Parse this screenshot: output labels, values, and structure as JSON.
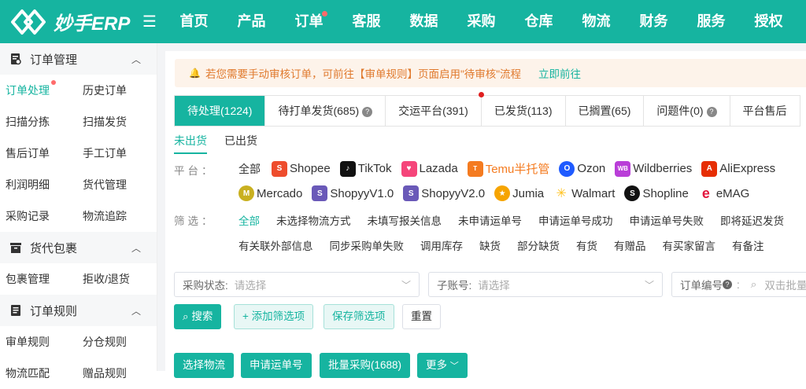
{
  "app": {
    "logo_text": "妙手ERP"
  },
  "nav": {
    "items": [
      {
        "label": "首页"
      },
      {
        "label": "产品"
      },
      {
        "label": "订单"
      },
      {
        "label": "客服"
      },
      {
        "label": "数据"
      },
      {
        "label": "采购"
      },
      {
        "label": "仓库"
      },
      {
        "label": "物流"
      },
      {
        "label": "财务"
      },
      {
        "label": "服务"
      },
      {
        "label": "授权"
      }
    ]
  },
  "sidebar": {
    "groups": [
      {
        "title": "订单管理",
        "items": [
          "订单处理",
          "历史订单",
          "扫描分拣",
          "扫描发货",
          "售后订单",
          "手工订单",
          "利润明细",
          "货代管理",
          "采购记录",
          "物流追踪"
        ]
      },
      {
        "title": "货代包裹",
        "items": [
          "包裹管理",
          "拒收/退货"
        ]
      },
      {
        "title": "订单规则",
        "items": [
          "审单规则",
          "分仓规则",
          "物流匹配",
          "赠品规则"
        ]
      }
    ]
  },
  "notice": {
    "text": "若您需要手动审核订单，可前往【审单规则】页面启用\"待审核\"流程",
    "link": "立即前往"
  },
  "tabs": [
    {
      "label": "待处理(1224)"
    },
    {
      "label": "待打单发货(685)"
    },
    {
      "label": "交运平台(391)"
    },
    {
      "label": "已发货(113)"
    },
    {
      "label": "已搁置(65)"
    },
    {
      "label": "问题件(0)"
    },
    {
      "label": "平台售后"
    }
  ],
  "subtabs": [
    "未出货",
    "已出货"
  ],
  "platform": {
    "label": "平台：",
    "all": "全部",
    "items": [
      {
        "name": "Shopee",
        "color": "#ee4d2d"
      },
      {
        "name": "TikTok",
        "color": "#111111"
      },
      {
        "name": "Lazada",
        "color": "#f5457a"
      },
      {
        "name": "Temu半托管",
        "color": "#f47b20"
      },
      {
        "name": "Ozon",
        "color": "#1f5bff"
      },
      {
        "name": "Wildberries",
        "color": "#b93ed8"
      },
      {
        "name": "AliExpress",
        "color": "#e62e04"
      },
      {
        "name": "Mercado",
        "color": "#c9b020"
      },
      {
        "name": "ShopyyV1.0",
        "color": "#6a59b8"
      },
      {
        "name": "ShopyyV2.0",
        "color": "#6a59b8"
      },
      {
        "name": "Jumia",
        "color": "#f6a400"
      },
      {
        "name": "Walmart",
        "color": "#ffc220"
      },
      {
        "name": "Shopline",
        "color": "#111111"
      },
      {
        "name": "eMAG",
        "color": "#e3173e"
      }
    ]
  },
  "filters": {
    "label": "筛选：",
    "row1": [
      "全部",
      "未选择物流方式",
      "未填写报关信息",
      "未申请运单号",
      "申请运单号成功",
      "申请运单号失败",
      "即将延迟发货"
    ],
    "row2": [
      "有关联外部信息",
      "同步采购单失败",
      "调用库存",
      "缺货",
      "部分缺货",
      "有货",
      "有赠品",
      "有买家留言",
      "有备注"
    ]
  },
  "search": {
    "purchase_status_label": "采购状态:",
    "purchase_status_placeholder": "请选择",
    "sub_account_label": "子账号:",
    "sub_account_placeholder": "请选择",
    "order_no_label": "订单编号",
    "order_no_placeholder": "双击批量"
  },
  "buttons": {
    "search": "搜索",
    "add_filter": "+ 添加筛选项",
    "save_filter": "保存筛选项",
    "reset": "重置",
    "select_logistics": "选择物流",
    "apply_tracking": "申请运单号",
    "bulk_purchase": "批量采购(1688)",
    "more": "更多"
  },
  "colors": {
    "brand": "#16b4a0",
    "notice_text": "#e07a2e",
    "notice_bg": "#fdf3ea",
    "badge": "#ff6b6b"
  }
}
